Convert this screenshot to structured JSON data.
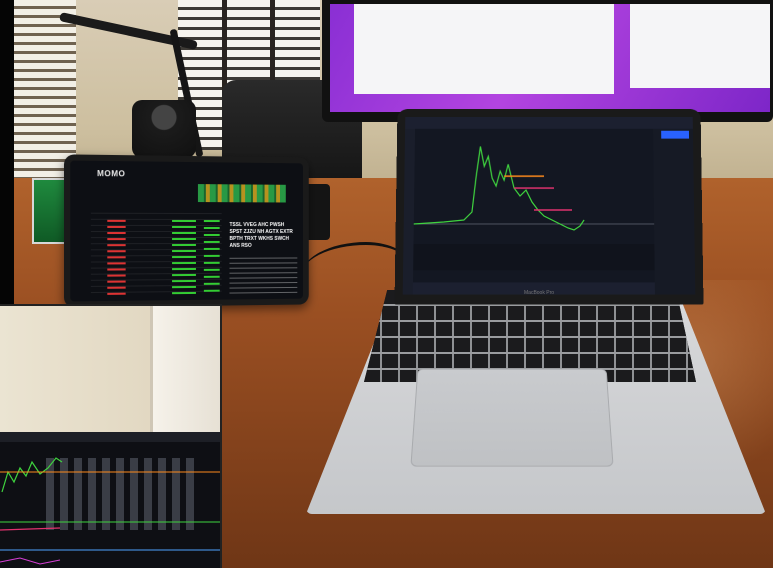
{
  "photo": {
    "tablet": {
      "app_logo": "MOMO",
      "news_headline": "TSSL VVEG AHC PWSH SPST ZJZU NH AGTX EXTR BPTH TRXT WKHS SWCH ANS RSO"
    },
    "laptop": {
      "brand": "MacBook Pro"
    }
  },
  "colors": {
    "chart_bg": "#131722",
    "price_line": "#3fd43f",
    "resistance_line": "#e0326e",
    "orange_line": "#ff8a1c",
    "monitor_purple": "#8a2fd4",
    "desk_wood": "#9a4f22"
  }
}
